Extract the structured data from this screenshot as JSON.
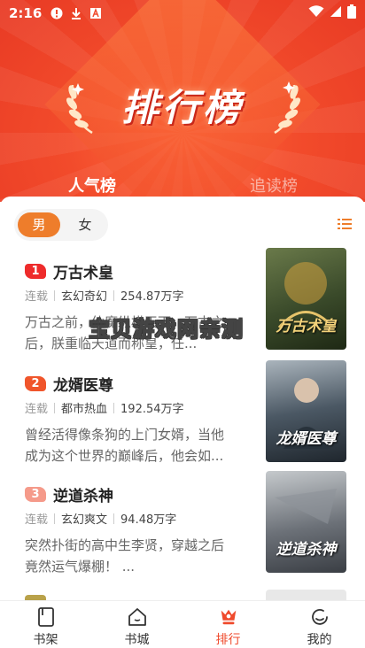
{
  "status_bar": {
    "time": "2:16"
  },
  "hero": {
    "title": "排行榜"
  },
  "top_tabs": [
    {
      "label": "人气榜",
      "active": true
    },
    {
      "label": "追读榜",
      "active": false
    }
  ],
  "gender_toggle": {
    "male": "男",
    "female": "女",
    "selected": "男"
  },
  "books": [
    {
      "rank": "1",
      "rank_color": "#ee2b2b",
      "title": "万古术皇",
      "status": "连载",
      "genre": "玄幻奇幻",
      "words": "254.87万字",
      "desc": "万古之前，仙魔纵横天下，万古之后，朕重临天道而称皇，任...",
      "cover_title": "万古术皇",
      "cover_color": "#3a4a2a"
    },
    {
      "rank": "2",
      "rank_color": "#f0552b",
      "title": "龙婿医尊",
      "status": "连载",
      "genre": "都市热血",
      "words": "192.54万字",
      "desc": "曾经活得像条狗的上门女婿，当他成为这个世界的巅峰后，他会如...",
      "cover_title": "龙婿医尊",
      "cover_color": "#2f3a44"
    },
    {
      "rank": "3",
      "rank_color": "#f59a8a",
      "title": "逆道杀神",
      "status": "连载",
      "genre": "玄幻爽文",
      "words": "94.48万字",
      "desc": "突然扑街的高中生李贤，穿越之后竟然运气爆棚！ ...",
      "cover_title": "逆道杀神",
      "cover_color": "#5a5f66"
    }
  ],
  "watermark": "宝贝游戏网亲测",
  "bottom_nav": [
    {
      "label": "书架",
      "icon": "bookshelf-icon",
      "active": false
    },
    {
      "label": "书城",
      "icon": "bookstore-icon",
      "active": false
    },
    {
      "label": "排行",
      "icon": "ranking-icon",
      "active": true
    },
    {
      "label": "我的",
      "icon": "profile-icon",
      "active": false
    }
  ],
  "colors": {
    "accent": "#ef4a2c",
    "male_selected": "#ee7d2b"
  }
}
